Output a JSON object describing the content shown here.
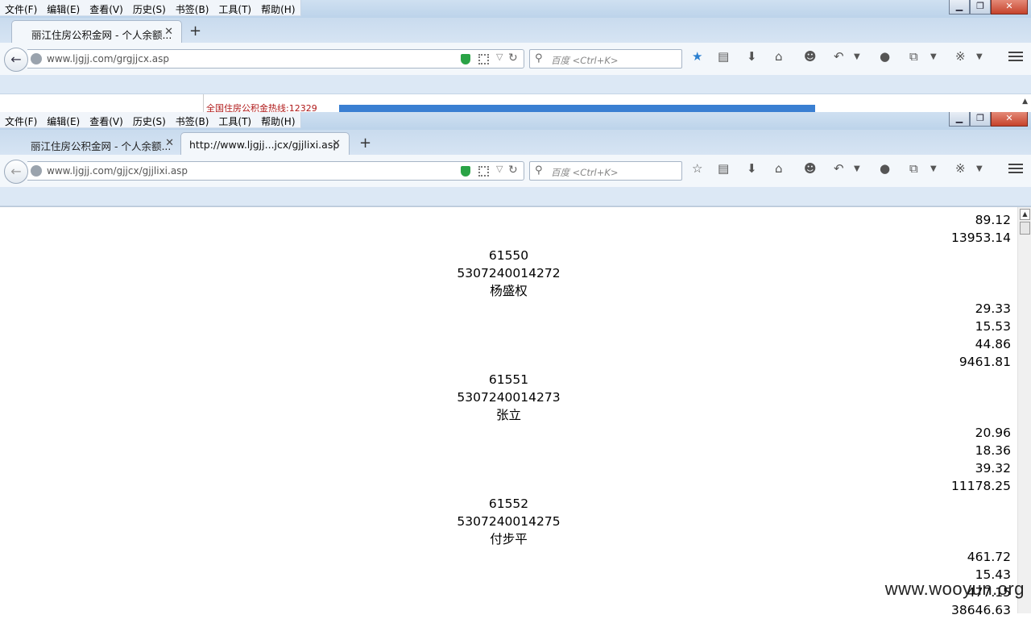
{
  "menu": [
    "文件(F)",
    "编辑(E)",
    "查看(V)",
    "历史(S)",
    "书签(B)",
    "工具(T)",
    "帮助(H)"
  ],
  "window_controls": {
    "min": "▁",
    "max": "❐",
    "close": "✕"
  },
  "window1": {
    "tabs": [
      {
        "title": "丽江住房公积金网 - 个人余额..."
      }
    ],
    "url": "www.ljgjj.com/grgjjcx.asp",
    "search_placeholder": "百度 <Ctrl+K>",
    "hotline": "全国住房公积金热线:12329"
  },
  "window2": {
    "tabs": [
      {
        "title": "丽江住房公积金网 - 个人余额..."
      },
      {
        "title": "http://www.ljgjj...jcx/gjjlixi.asp"
      }
    ],
    "url": "www.ljgjj.com/gjjcx/gjjlixi.asp",
    "search_placeholder": "百度 <Ctrl+K>",
    "rows": [
      {
        "text": "89.12",
        "align": "right"
      },
      {
        "text": "13953.14",
        "align": "right"
      },
      {
        "text": "61550",
        "align": "center"
      },
      {
        "text": "5307240014272",
        "align": "center"
      },
      {
        "text": "杨盛权",
        "align": "center"
      },
      {
        "text": "29.33",
        "align": "right"
      },
      {
        "text": "15.53",
        "align": "right"
      },
      {
        "text": "44.86",
        "align": "right"
      },
      {
        "text": "9461.81",
        "align": "right"
      },
      {
        "text": "61551",
        "align": "center"
      },
      {
        "text": "5307240014273",
        "align": "center"
      },
      {
        "text": "张立",
        "align": "center"
      },
      {
        "text": "20.96",
        "align": "right"
      },
      {
        "text": "18.36",
        "align": "right"
      },
      {
        "text": "39.32",
        "align": "right"
      },
      {
        "text": "11178.25",
        "align": "right"
      },
      {
        "text": "61552",
        "align": "center"
      },
      {
        "text": "5307240014275",
        "align": "center"
      },
      {
        "text": "付步平",
        "align": "center"
      },
      {
        "text": "461.72",
        "align": "right"
      },
      {
        "text": "15.43",
        "align": "right"
      },
      {
        "text": "477.15",
        "align": "right"
      },
      {
        "text": "38646.63",
        "align": "right"
      }
    ]
  },
  "watermark": "www.wooyun.org",
  "colors": {
    "accent": "#3a7fd2",
    "hotline": "#b01a1a",
    "shield": "#2aa346",
    "close": "#c6432c"
  }
}
